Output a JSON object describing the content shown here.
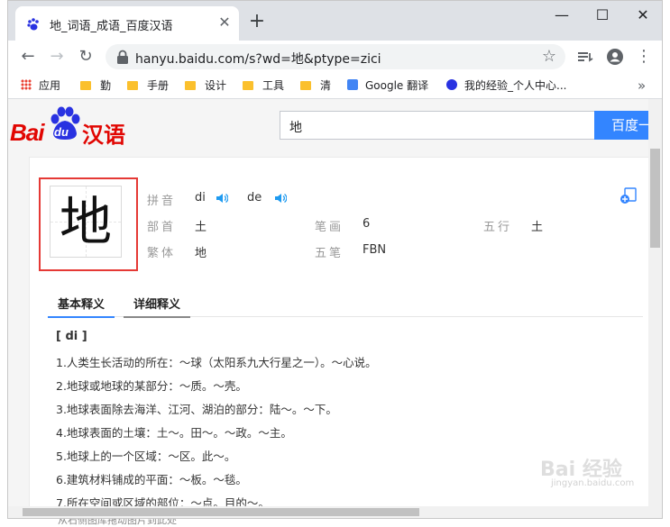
{
  "browser": {
    "tab_title": "地_词语_成语_百度汉语",
    "url": "hanyu.baidu.com/s?wd=地&ptype=zici",
    "bookmarks": [
      {
        "label": "应用",
        "type": "apps"
      },
      {
        "label": "勤",
        "type": "folder"
      },
      {
        "label": "手册",
        "type": "folder"
      },
      {
        "label": "设计",
        "type": "folder"
      },
      {
        "label": "工具",
        "type": "folder"
      },
      {
        "label": "清",
        "type": "folder"
      },
      {
        "label": "Google 翻译",
        "type": "google"
      },
      {
        "label": "我的经验_个人中心...",
        "type": "paw"
      }
    ],
    "more_bookmarks": "»"
  },
  "site": {
    "logo_text_bai": "Bai",
    "logo_text_du": "du",
    "logo_text_hanyu": "汉语",
    "search_value": "地",
    "search_button": "百度一"
  },
  "character": {
    "glyph": "地",
    "pinyin_label": "拼音",
    "pinyin": [
      "di",
      "de"
    ],
    "radical_label": "部首",
    "radical": "土",
    "strokes_label": "笔画",
    "strokes": "6",
    "wuxing_label": "五行",
    "wuxing": "土",
    "traditional_label": "繁体",
    "traditional": "地",
    "wubi_label": "五笔",
    "wubi": "FBN"
  },
  "tabs": {
    "basic": "基本释义",
    "detailed": "详细释义"
  },
  "definitions": {
    "header": "[ di ]",
    "items": [
      "1.人类生长活动的所在：～球（太阳系九大行星之一）。～心说。",
      "2.地球或地球的某部分：～质。～壳。",
      "3.地球表面除去海洋、江河、湖泊的部分：陆～。～下。",
      "4.地球表面的土壤：土～。田～。～政。～主。",
      "5.地球上的一个区域：～区。此～。",
      "6.建筑材料铺成的平面：～板。～毯。",
      "7.所在空间或区域的部位：～点。目的～。"
    ]
  },
  "watermark": {
    "text": "Bai 经验",
    "sub": "jingyan.baidu.com"
  },
  "background_text": "从石侧图库拖动图片到此处"
}
